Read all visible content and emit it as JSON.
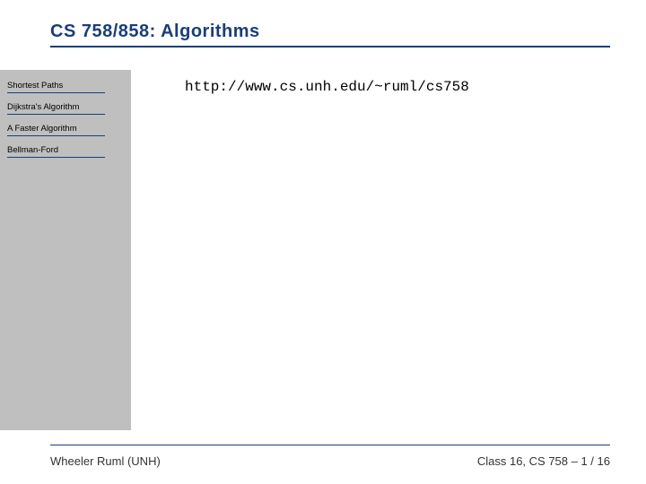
{
  "header": {
    "title": "CS 758/858: Algorithms"
  },
  "sidebar": {
    "items": [
      {
        "label": "Shortest Paths"
      },
      {
        "label": "Dijkstra's Algorithm"
      },
      {
        "label": "A Faster Algorithm"
      },
      {
        "label": "Bellman-Ford"
      }
    ]
  },
  "main": {
    "url": "http://www.cs.unh.edu/~ruml/cs758"
  },
  "footer": {
    "author": "Wheeler Ruml (UNH)",
    "pageinfo": "Class 16, CS 758 – 1 / 16"
  }
}
